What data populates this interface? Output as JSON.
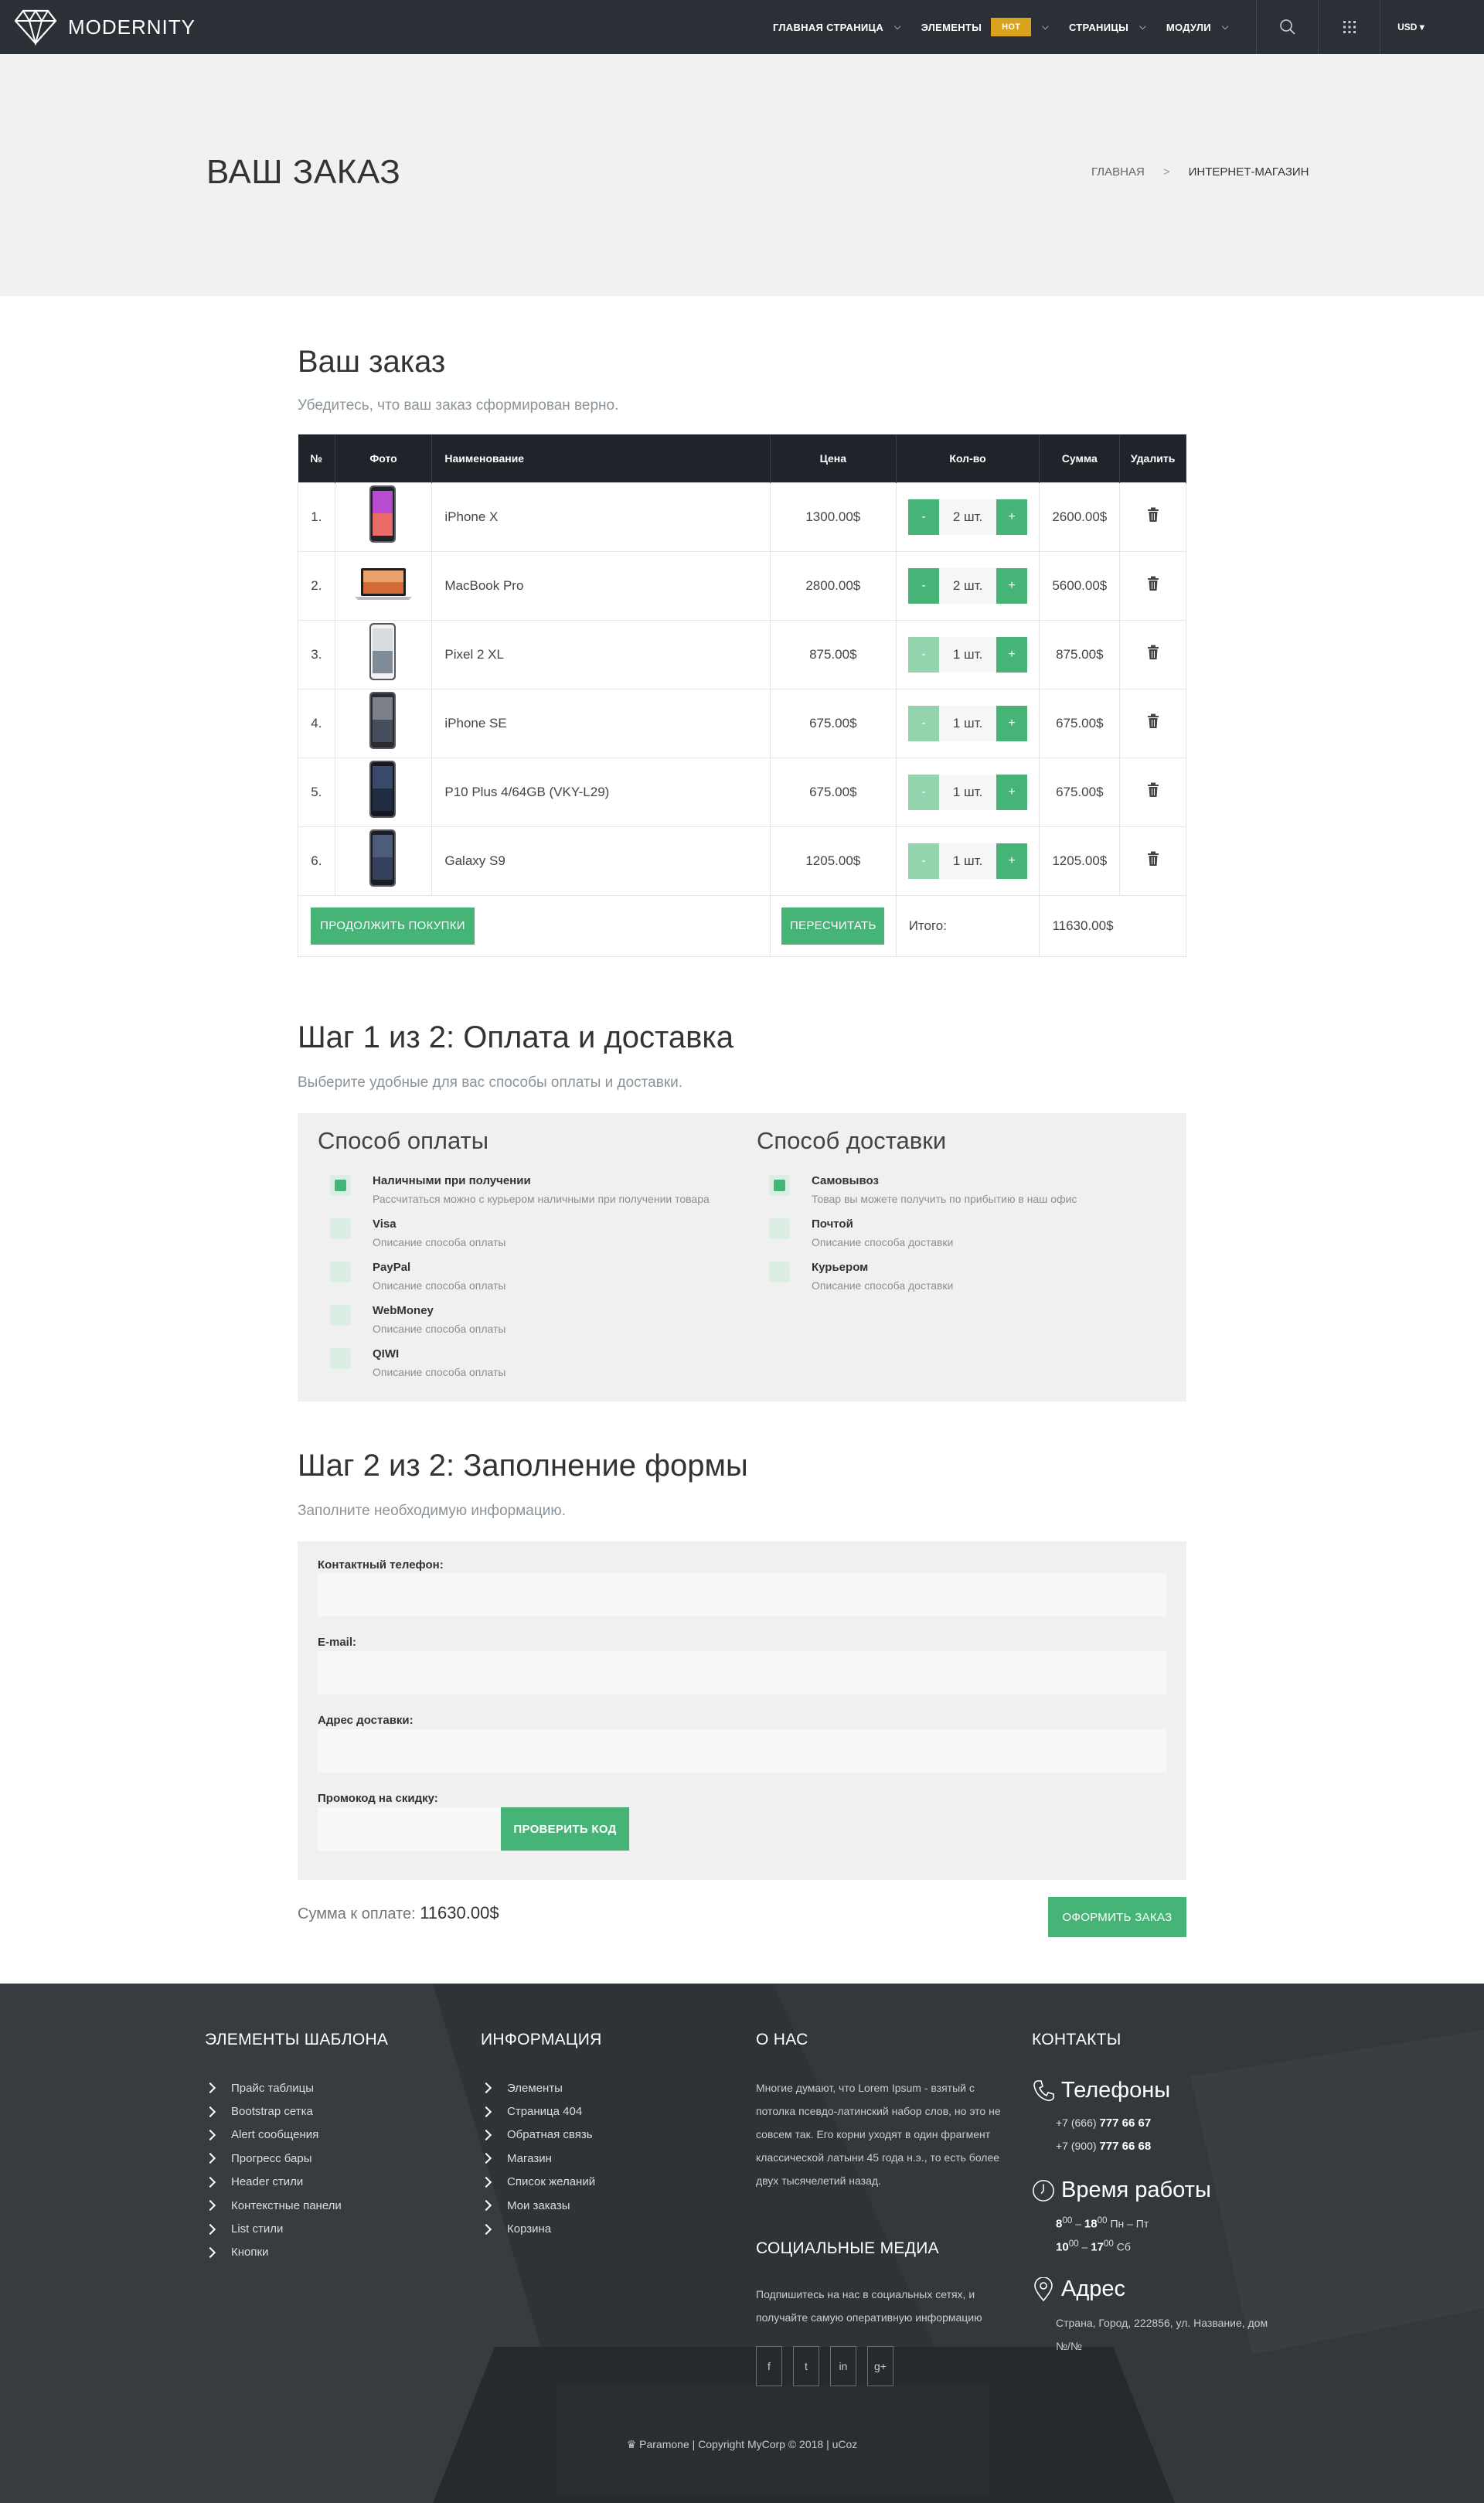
{
  "nav": {
    "logo": "MODERNITY",
    "items": [
      {
        "label": "ГЛАВНАЯ СТРАНИЦА"
      },
      {
        "label": "ЭЛЕМЕНТЫ",
        "badge": "HOT"
      },
      {
        "label": "СТРАНИЦЫ"
      },
      {
        "label": "МОДУЛИ"
      }
    ],
    "currency": "USD ▾"
  },
  "hero": {
    "title": "ВАШ ЗАКАЗ",
    "breadcrumb": [
      "ГЛАВНАЯ",
      "ИНТЕРНЕТ-МАГАЗИН"
    ]
  },
  "order": {
    "title": "Ваш заказ",
    "subtitle": "Убедитесь, что ваш заказ сформирован верно.",
    "headers": {
      "num": "№",
      "photo": "Фото",
      "name": "Наименование",
      "price": "Цена",
      "qty": "Кол-во",
      "sum": "Сумма",
      "del": "Удалить"
    },
    "rows": [
      {
        "num": "1.",
        "name": "iPhone X",
        "price": "1300.00$",
        "qty": "2 шт.",
        "sum": "2600.00$",
        "minus_active": true
      },
      {
        "num": "2.",
        "name": "MacBook Pro",
        "price": "2800.00$",
        "qty": "2 шт.",
        "sum": "5600.00$",
        "minus_active": true
      },
      {
        "num": "3.",
        "name": "Pixel 2 XL",
        "price": "875.00$",
        "qty": "1 шт.",
        "sum": "875.00$",
        "minus_active": false
      },
      {
        "num": "4.",
        "name": "iPhone SE",
        "price": "675.00$",
        "qty": "1 шт.",
        "sum": "675.00$",
        "minus_active": false
      },
      {
        "num": "5.",
        "name": "P10 Plus 4/64GB (VKY-L29)",
        "price": "675.00$",
        "qty": "1 шт.",
        "sum": "675.00$",
        "minus_active": false
      },
      {
        "num": "6.",
        "name": "Galaxy S9",
        "price": "1205.00$",
        "qty": "1 шт.",
        "sum": "1205.00$",
        "minus_active": false
      }
    ],
    "minus": "-",
    "plus": "+",
    "continue_btn": "ПРОДОЛЖИТЬ ПОКУПКИ",
    "recalc_btn": "ПЕРЕСЧИТАТЬ",
    "total_label": "Итого:",
    "total_value": "11630.00$"
  },
  "step1": {
    "title": "Шаг 1 из 2: Оплата и доставка",
    "subtitle": "Выберите удобные для вас способы оплаты и доставки.",
    "payment_title": "Способ оплаты",
    "payment": [
      {
        "label": "Наличными при получении",
        "desc": "Рассчитаться можно с курьером наличными при получении товара",
        "checked": true
      },
      {
        "label": "Visa",
        "desc": "Описание способа оплаты",
        "checked": false
      },
      {
        "label": "PayPal",
        "desc": "Описание способа оплаты",
        "checked": false
      },
      {
        "label": "WebMoney",
        "desc": "Описание способа оплаты",
        "checked": false
      },
      {
        "label": "QIWI",
        "desc": "Описание способа оплаты",
        "checked": false
      }
    ],
    "delivery_title": "Способ доставки",
    "delivery": [
      {
        "label": "Самовывоз",
        "desc": "Товар вы можете получить по прибытию в наш офис",
        "checked": true
      },
      {
        "label": "Почтой",
        "desc": "Описание способа доставки",
        "checked": false
      },
      {
        "label": "Курьером",
        "desc": "Описание способа доставки",
        "checked": false
      }
    ]
  },
  "step2": {
    "title": "Шаг 2 из 2: Заполнение формы",
    "subtitle": "Заполните необходимую информацию.",
    "phone_label": "Контактный телефон:",
    "email_label": "E-mail:",
    "address_label": "Адрес доставки:",
    "promo_label": "Промокод на скидку:",
    "promo_btn": "ПРОВЕРИТЬ КОД",
    "sum_label": "Сумма к оплате:",
    "sum_value": "11630.00$",
    "order_btn": "ОФОРМИТЬ ЗАКАЗ"
  },
  "footer": {
    "col1_title": "ЭЛЕМЕНТЫ ШАБЛОНА",
    "col1_items": [
      "Прайс таблицы",
      "Bootstrap сетка",
      "Alert сообщения",
      "Прогресс бары",
      "Header стили",
      "Контекстные панели",
      "List стили",
      "Кнопки"
    ],
    "col2_title": "ИНФОРМАЦИЯ",
    "col2_items": [
      "Элементы",
      "Страница 404",
      "Обратная связь",
      "Магазин",
      "Список желаний",
      "Мои заказы",
      "Корзина"
    ],
    "about_title": "О НАС",
    "about_text": "Многие думают, что Lorem Ipsum - взятый с потолка псевдо-латинский набор слов, но это не совсем так. Его корни уходят в один фрагмент классической латыни 45 года н.э., то есть более двух тысячелетий назад.",
    "social_title": "СОЦИАЛЬНЫЕ МЕДИА",
    "social_text": "Подпишитесь на нас в социальных сетях, и получайте самую оперативную информацию",
    "social_icons": [
      "f",
      "t",
      "in",
      "g+"
    ],
    "contacts_title": "КОНТАКТЫ",
    "phones_title": "Телефоны",
    "phone1_code": "+7 (666)",
    "phone1_num": "777 66 67",
    "phone2_code": "+7 (900)",
    "phone2_num": "777 66 68",
    "hours_title": "Время работы",
    "hours1_from": "8",
    "hours1_to": "18",
    "hours1_days": "Пн – Пт",
    "hours2_from": "10",
    "hours2_to": "17",
    "hours2_days": "Сб",
    "minutes": "00",
    "address_title": "Адрес",
    "address_text": "Страна, Город, 222856, ул. Название, дом №/№",
    "copyright": "Paramone | Copyright MyCorp © 2018 | uCoz"
  }
}
